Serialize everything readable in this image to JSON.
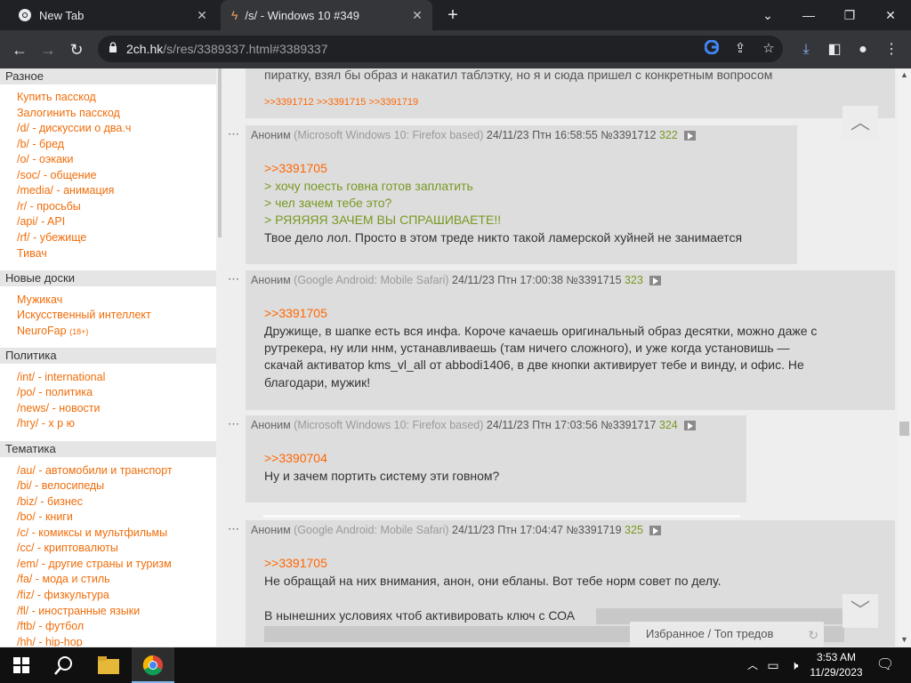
{
  "browser": {
    "tabs": [
      {
        "title": "New Tab"
      },
      {
        "title": "/s/ - Windows 10 #349"
      }
    ],
    "url_host": "2ch.hk",
    "url_path": "/s/res/3389337.html#3389337"
  },
  "sidebar": {
    "sections": [
      {
        "title": "Разное",
        "items": [
          "Купить пасскод",
          "Залогинить пасскод",
          "/d/ - дискуссии о два.ч",
          "/b/ - бред",
          "/o/ - оэкаки",
          "/soc/ - общение",
          "/media/ - анимация",
          "/r/ - просьбы",
          "/api/ - API",
          "/rf/ - убежище",
          "Тивач"
        ]
      },
      {
        "title": "Новые доски",
        "items": [
          "Мужикач",
          "Искусственный интеллект",
          "NeuroFap"
        ],
        "badge": "(18+)"
      },
      {
        "title": "Политика",
        "items": [
          "/int/ - international",
          "/po/ - политика",
          "/news/ - новости",
          "/hry/ - х р ю"
        ]
      },
      {
        "title": "Тематика",
        "items": [
          "/au/ - автомобили и транспорт",
          "/bi/ - велосипеды",
          "/biz/ - бизнес",
          "/bo/ - книги",
          "/c/ - комиксы и мультфильмы",
          "/cc/ - криптовалюты",
          "/em/ - другие страны и туризм",
          "/fa/ - мода и стиль",
          "/fiz/ - физкультура",
          "/fl/ - иностранные языки",
          "/ftb/ - футбол",
          "/hh/ - hip-hop"
        ]
      }
    ]
  },
  "posts": [
    {
      "partial_text": "пиратку, взял бы образ и накатил таблэтку, но я и сюда пришел с конкретным вопросом",
      "replies": ">>3391712 >>3391715 >>3391719"
    },
    {
      "name": "Аноним",
      "ua": "(Microsoft Windows 10: Firefox based)",
      "date": "24/11/23 Птн 16:58:55",
      "num": "№3391712",
      "count": "322",
      "lines": [
        {
          "t": ">>3391705",
          "k": "ref"
        },
        {
          "t": "> хочу поесть говна готов заплатить",
          "k": "green"
        },
        {
          "t": "> чел зачем тебе это?",
          "k": "green"
        },
        {
          "t": "> РЯЯЯЯЯ ЗАЧЕМ ВЫ СПРАШИВАЕТЕ!!",
          "k": "green"
        },
        {
          "t": "Твое дело лол. Просто в этом треде никто такой ламерской хуйней не занимается",
          "k": "text"
        }
      ]
    },
    {
      "name": "Аноним",
      "ua": "(Google Android: Mobile Safari)",
      "date": "24/11/23 Птн 17:00:38",
      "num": "№3391715",
      "count": "323",
      "lines": [
        {
          "t": ">>3391705",
          "k": "ref"
        },
        {
          "t": "Дружище, в шапке есть вся инфа. Короче качаешь оригинальный образ десятки, можно даже с",
          "k": "text"
        },
        {
          "t": "рутрекера, ну или ннм, устанавливаешь (там ничего сложного), и уже когда установишь —",
          "k": "text"
        },
        {
          "t": "скачай активатор kms_vl_all от abbodi1406, в две кнопки активирует тебе и винду, и офис. Не",
          "k": "text"
        },
        {
          "t": "благодари, мужик!",
          "k": "text"
        }
      ]
    },
    {
      "name": "Аноним",
      "ua": "(Microsoft Windows 10: Firefox based)",
      "date": "24/11/23 Птн 17:03:56",
      "num": "№3391717",
      "count": "324",
      "lines": [
        {
          "t": ">>3390704",
          "k": "ref"
        },
        {
          "t": "Ну и зачем портить систему эти говном?",
          "k": "text"
        }
      ]
    },
    {
      "name": "Аноним",
      "ua": "(Google Android: Mobile Safari)",
      "date": "24/11/23 Птн 17:04:47",
      "num": "№3391719",
      "count": "325",
      "lines": [
        {
          "t": ">>3391705",
          "k": "ref"
        },
        {
          "t": "Не обращай на них внимания, анон, они ебланы. Вот тебе норм совет по делу.",
          "k": "text"
        },
        {
          "t": "",
          "k": "text"
        },
        {
          "t": "В нынешних условиях чтоб активировать ключ с СОА",
          "k": "text"
        }
      ]
    }
  ],
  "favbar": {
    "label": "Избранное / Топ тредов"
  },
  "taskbar": {
    "time": "3:53 AM",
    "date": "11/29/2023"
  },
  "colors": {
    "link": "#f06d0a",
    "ref": "#ff6600",
    "greentext": "#789922",
    "post_bg": "#dddddd"
  },
  "icons": [
    "chrome-icon",
    "bolt-icon",
    "back-icon",
    "forward-icon",
    "reload-icon",
    "lock-icon",
    "google-icon",
    "share-icon",
    "star-icon",
    "download-icon",
    "sidepanel-icon",
    "profile-icon",
    "menu-icon",
    "windows-start-icon",
    "search-icon",
    "file-explorer-icon",
    "chrome-taskbar-icon",
    "network-icon",
    "volume-icon",
    "notification-icon"
  ]
}
